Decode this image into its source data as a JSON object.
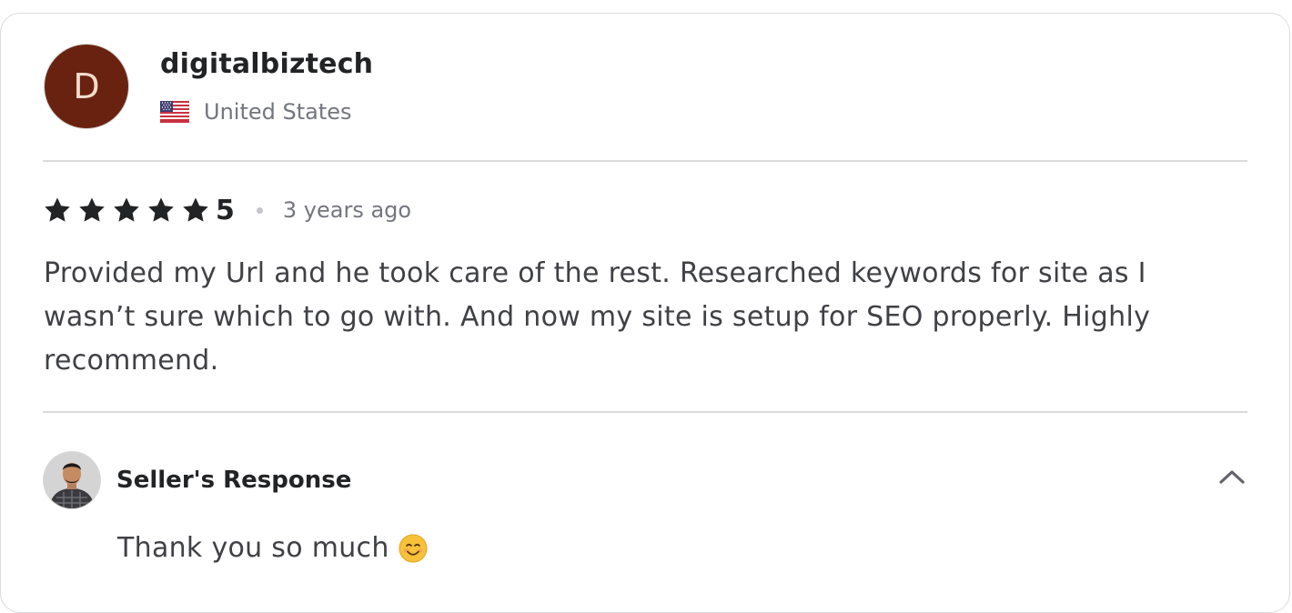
{
  "reviewer": {
    "initial": "D",
    "name": "digitalbiztech",
    "country": "United States",
    "avatar_color": "#6a2210"
  },
  "review": {
    "rating": "5",
    "stars": 5,
    "time_ago": "3 years ago",
    "text": "Provided my Url and he took care of the rest. Researched keywords for site as I wasn’t sure which to go with. And now my site is setup for SEO properly. Highly recommend."
  },
  "seller_response": {
    "label": "Seller's Response",
    "text": "Thank you so much",
    "emoji": "smiling-face-emoji",
    "collapse_icon": "chevron-up-icon"
  },
  "colors": {
    "text_primary": "#222325",
    "text_secondary": "#74767e",
    "divider": "#dadbdd"
  }
}
